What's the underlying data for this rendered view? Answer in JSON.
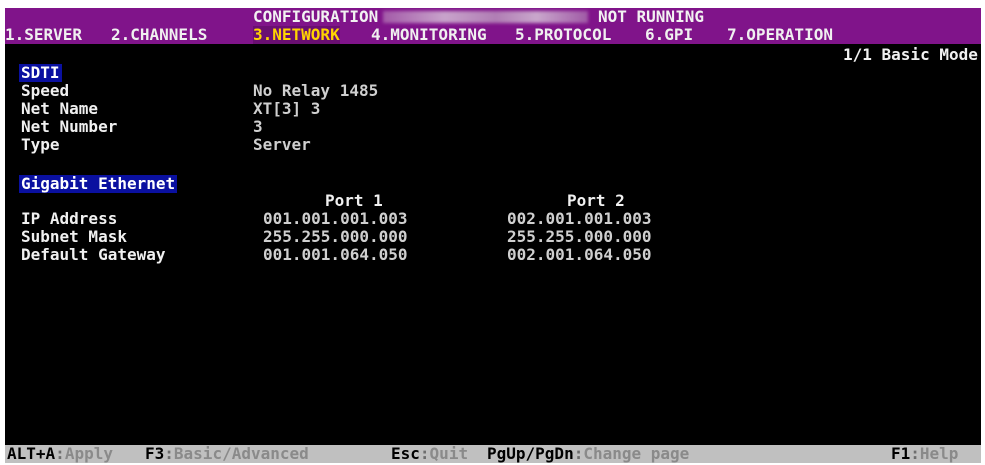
{
  "header": {
    "title": "CONFIGURATION",
    "status": "NOT RUNNING"
  },
  "tabs": [
    {
      "label": "1.SERVER"
    },
    {
      "label": "2.CHANNELS"
    },
    {
      "label": "3.NETWORK",
      "active": true
    },
    {
      "label": "4.MONITORING"
    },
    {
      "label": "5.PROTOCOL"
    },
    {
      "label": "6.GPI"
    },
    {
      "label": "7.OPERATION"
    }
  ],
  "page_mode": "1/1 Basic Mode",
  "sdti": {
    "title": "SDTI",
    "fields": [
      {
        "label": "Speed",
        "value": "No Relay 1485"
      },
      {
        "label": "Net Name",
        "value": "XT[3] 3"
      },
      {
        "label": "Net Number",
        "value": "3"
      },
      {
        "label": "Type",
        "value": "Server"
      }
    ]
  },
  "ethernet": {
    "title": "Gigabit Ethernet",
    "port_headers": [
      "Port 1",
      "Port 2"
    ],
    "rows": [
      {
        "label": "IP Address",
        "port1": "001.001.001.003",
        "port2": "002.001.001.003"
      },
      {
        "label": "Subnet Mask",
        "port1": "255.255.000.000",
        "port2": "255.255.000.000"
      },
      {
        "label": "Default Gateway",
        "port1": "001.001.064.050",
        "port2": "002.001.064.050"
      }
    ]
  },
  "footer": {
    "items": [
      {
        "key": "ALT+A",
        "sep": ":",
        "desc": "Apply"
      },
      {
        "key": "F3",
        "sep": ":",
        "desc": "Basic/Advanced"
      },
      {
        "key": "Esc",
        "sep": ":",
        "desc": "Quit"
      },
      {
        "key": "PgUp/PgDn",
        "sep": ":",
        "desc": "Change page"
      },
      {
        "key": "F1",
        "sep": ":",
        "desc": "Help"
      }
    ]
  },
  "colors": {
    "title_bar": "#80148a",
    "active_tab_text": "#ffd400",
    "section_header_bg": "#0a10a0",
    "screen_bg": "#000000",
    "footer_bg": "#c0c0c0"
  }
}
